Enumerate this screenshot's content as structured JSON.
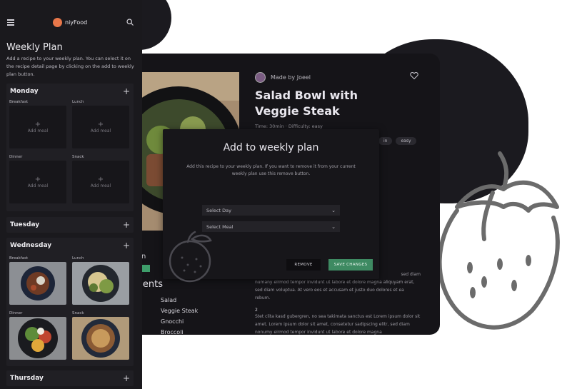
{
  "phone": {
    "brand": "niyFood",
    "page_title": "Weekly Plan",
    "page_description": "Add a recipe to your weekly plan. You can select it on the recipe detail page by clicking on the add to weekly plan button.",
    "add_meal_label": "Add meal",
    "days": [
      {
        "name": "Monday",
        "meals": [
          "Breakfast",
          "Lunch",
          "Dinner",
          "Snack"
        ]
      },
      {
        "name": "Tuesday"
      },
      {
        "name": "Wednesday",
        "meals": [
          "Breakfast",
          "Lunch",
          "Dinner",
          "Snack"
        ]
      },
      {
        "name": "Thursday"
      }
    ]
  },
  "recipe": {
    "author": "Made by Joeel",
    "title": "Salad Bowl with Veggie Steak",
    "meta": "Time: 30min  ·  Difficulty: easy",
    "tags": [
      "in",
      "easy"
    ],
    "left_label": "n",
    "ingredients_title": "edients",
    "ingredients": [
      "Salad",
      "Veggie Steak",
      "Gnocchi",
      "Broccoli"
    ],
    "step_number": "2",
    "paragraph_1": "numany eirmod tempor invidunt ut labore et dolore magna aliquyam erat, sed diam voluptua. At vero eos et accusam et justo duo dolores et ea rebum.",
    "paragraph_1_prefix": "sed diam",
    "paragraph_2": "Stet clita kasd gubergren, no sea takimata sanctus est Lorem ipsum dolor sit amet. Lorem ipsum dolor sit amet, consetetur sadipscing elitr, sed diam nonumy eirmod tempor invidunt ut labore et dolore magna"
  },
  "modal": {
    "title": "Add to weekly plan",
    "description": "Add this recipe to your weekly plan. If you want to remove it from your current weekly plan use this remove button.",
    "select_day": "Select Day",
    "select_meal": "Select Meal",
    "remove_label": "REMOVE",
    "save_label": "SAVE CHANGES"
  },
  "colors": {
    "accent_green": "#3e8a62",
    "background_dark": "#151418",
    "brand_orange": "#e8774a"
  },
  "icons": [
    "hamburger-icon",
    "search-icon",
    "heart-icon",
    "plus-icon",
    "chevron-down-icon",
    "logo-icon"
  ]
}
